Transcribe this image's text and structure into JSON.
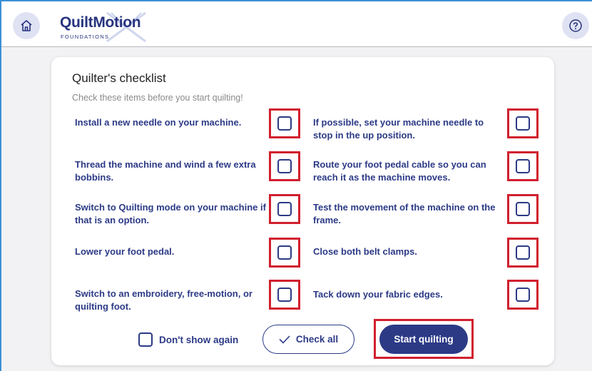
{
  "header": {
    "logo_main": "QuiltMotion",
    "logo_sub": "FOUNDATIONS",
    "home_icon": "home-icon",
    "help_icon": "help-icon"
  },
  "checklist": {
    "title": "Quilter's checklist",
    "subtitle": "Check these items before you start quilting!",
    "items": [
      {
        "label": "Install a new needle on your machine.",
        "checked": false
      },
      {
        "label": "If possible, set your machine needle to stop in the up position.",
        "checked": false
      },
      {
        "label": "Thread the machine and wind a few extra bobbins.",
        "checked": false
      },
      {
        "label": "Route your foot pedal cable so you can reach it as the machine moves.",
        "checked": false
      },
      {
        "label": "Switch to Quilting mode on your machine if that is an option.",
        "checked": false
      },
      {
        "label": "Test the movement of the machine on the frame.",
        "checked": false
      },
      {
        "label": "Lower your foot pedal.",
        "checked": false
      },
      {
        "label": "Close both belt clamps.",
        "checked": false
      },
      {
        "label": "Switch to an embroidery, free-motion, or quilting foot.",
        "checked": false
      },
      {
        "label": "Tack down your fabric edges.",
        "checked": false
      }
    ]
  },
  "footer": {
    "dont_show_label": "Don't show again",
    "check_all_label": "Check all",
    "start_label": "Start quilting"
  },
  "colors": {
    "brand": "#2c3a86",
    "highlight": "#d11f2e",
    "accent_border": "#3d8fd6"
  }
}
